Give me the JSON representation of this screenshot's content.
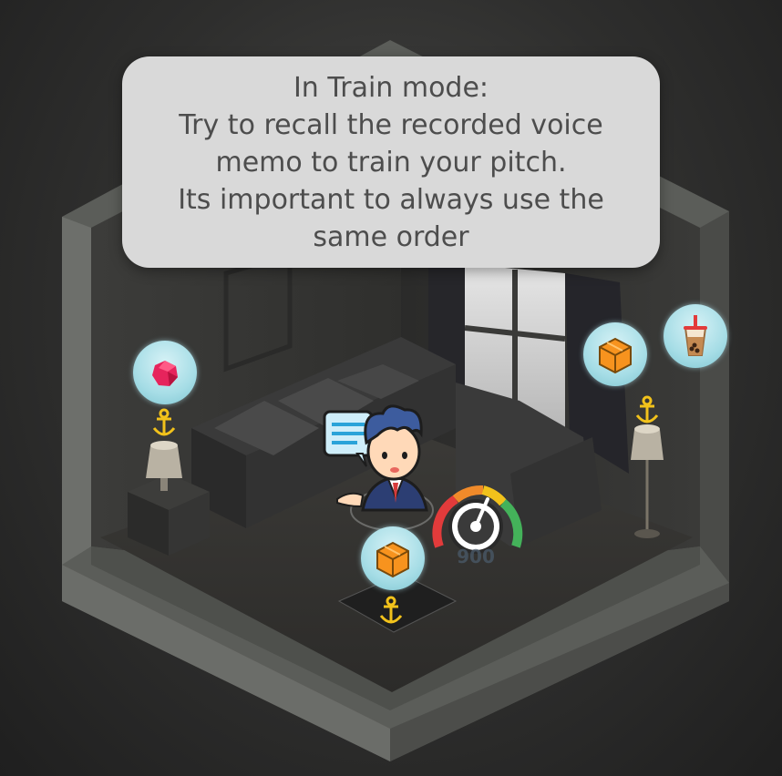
{
  "tooltip": {
    "lines": [
      "In Train mode:",
      "Try to recall the recorded voice",
      "memo to train your pitch.",
      "Its important to always use the",
      "same order"
    ]
  },
  "gauge": {
    "value_label": "900"
  },
  "colors": {
    "tooltip_bg": "#d9d9d9",
    "tooltip_text": "#4d4d4d",
    "bubble": "#a6dde6",
    "anchor": "#f2c21b",
    "box_item": "#f7931e",
    "gem_item": "#e6245c"
  },
  "items": {
    "left_gem": "gem-icon",
    "right_box": "box-icon",
    "right_drink": "bubble-tea-icon",
    "center_box": "box-icon"
  }
}
